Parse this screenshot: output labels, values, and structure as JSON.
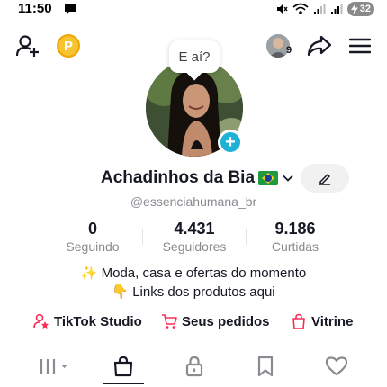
{
  "status_bar": {
    "time": "11:50",
    "battery": "32"
  },
  "top_nav": {
    "coin_label": "P",
    "avatar_badge": "9"
  },
  "profile": {
    "bubble_text": "E aí?",
    "display_name": "Achadinhos da Bia",
    "username": "@essenciahumana_br",
    "stats": [
      {
        "value": "0",
        "label": "Seguindo"
      },
      {
        "value": "4.431",
        "label": "Seguidores"
      },
      {
        "value": "9.186",
        "label": "Curtidas"
      }
    ],
    "bio": [
      "✨ Moda, casa e ofertas do momento",
      "👇 Links dos produtos aqui"
    ]
  },
  "quick_links": {
    "studio": "TikTok Studio",
    "orders": "Seus pedidos",
    "vitrine": "Vitrine"
  },
  "tabs": {
    "active": "shop",
    "items": [
      "grid",
      "shop",
      "private",
      "saved",
      "liked"
    ]
  },
  "colors": {
    "accent_pink": "#fe2c55",
    "plus_blue": "#20b2d6",
    "coin_yellow": "#f6c431",
    "text_primary": "#161823",
    "text_secondary": "#8a8b91"
  }
}
